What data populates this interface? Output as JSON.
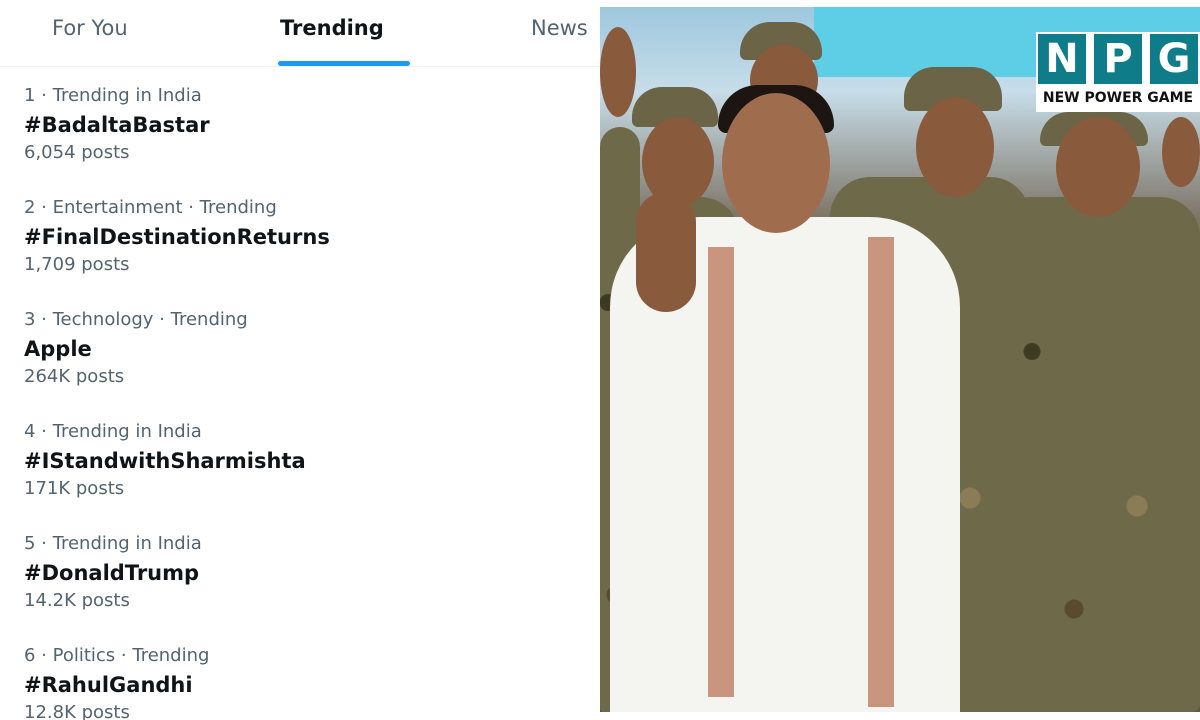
{
  "tabs": [
    {
      "label": "For You"
    },
    {
      "label": "Trending"
    },
    {
      "label": "News"
    }
  ],
  "active_tab": "Trending",
  "trends": [
    {
      "meta": "1 · Trending in India",
      "name": "#BadaltaBastar",
      "posts": "6,054 posts"
    },
    {
      "meta": "2 · Entertainment · Trending",
      "name": "#FinalDestinationReturns",
      "posts": "1,709 posts"
    },
    {
      "meta": "3 · Technology · Trending",
      "name": "Apple",
      "posts": "264K posts"
    },
    {
      "meta": "4 · Trending in India",
      "name": "#IStandwithSharmishta",
      "posts": "171K posts"
    },
    {
      "meta": "5 · Trending in India",
      "name": "#DonaldTrump",
      "posts": "14.2K posts"
    },
    {
      "meta": "6 · Politics · Trending",
      "name": "#RahulGandhi",
      "posts": "12.8K posts"
    }
  ],
  "logo": {
    "letters": [
      "N",
      "P",
      "G"
    ],
    "tagline": "NEW POWER GAME"
  },
  "colors": {
    "accent": "#1d9bf0",
    "logo_teal": "#0f7c8a"
  }
}
